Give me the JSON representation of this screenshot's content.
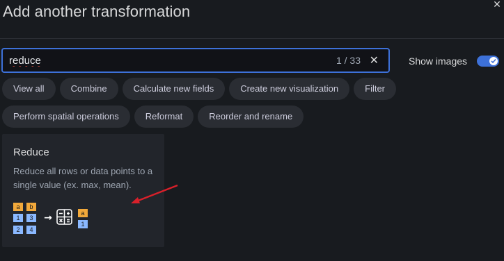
{
  "dialog": {
    "title": "Add another transformation",
    "close_glyph": "✕"
  },
  "search": {
    "value": "reduce",
    "count": "1 / 33",
    "clear_glyph": "✕"
  },
  "show_images": {
    "label": "Show images",
    "enabled": true
  },
  "filters": {
    "row1": [
      "View all",
      "Combine",
      "Calculate new fields",
      "Create new visualization",
      "Filter"
    ],
    "row2": [
      "Perform spatial operations",
      "Reformat",
      "Reorder and rename"
    ]
  },
  "card": {
    "title": "Reduce",
    "description": "Reduce all rows or data points to a single value (ex. max, mean).",
    "image": {
      "header_cells": [
        "a",
        "b"
      ],
      "rows": [
        [
          "1",
          "3"
        ],
        [
          "2",
          "4"
        ]
      ],
      "result_header": "a",
      "result_value": "1",
      "arrow_glyph": "→",
      "colors": {
        "header": "#f2a93b",
        "cell": "#8ab8ff",
        "icon": "#ffffff"
      }
    }
  },
  "annotation": {
    "color": "#d9202a"
  },
  "colors": {
    "accent": "#3d71d9",
    "background": "#181b1f",
    "chip": "#2a2d33"
  }
}
